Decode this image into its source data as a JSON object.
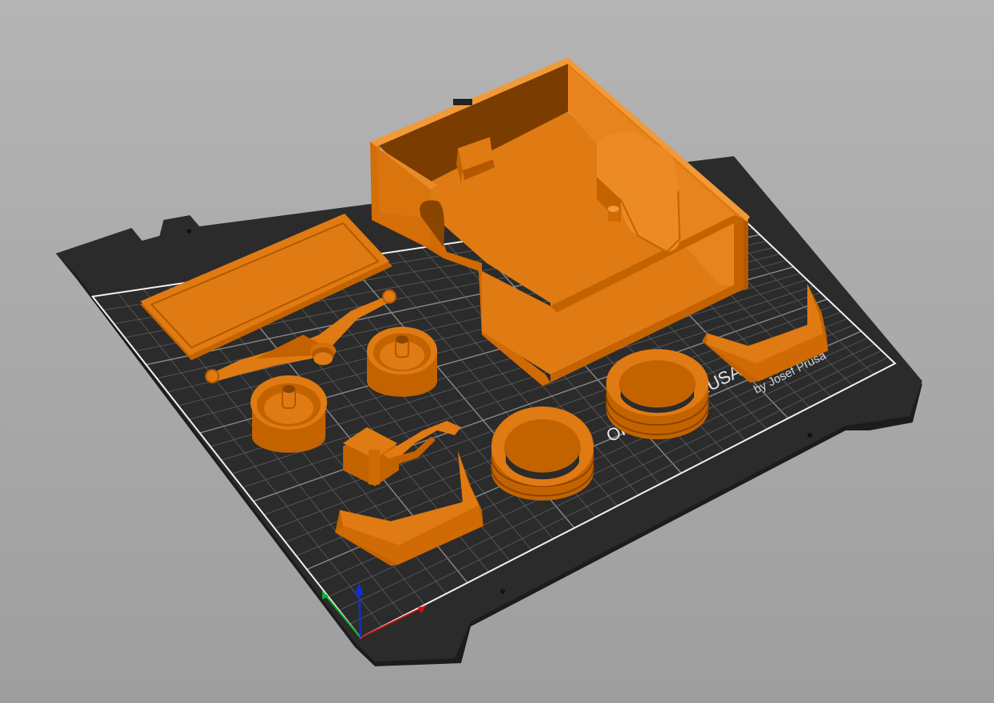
{
  "viewport": {
    "background_top": "#b4b4b4",
    "background_bottom": "#9e9e9e"
  },
  "bed": {
    "color": "#2a2a2a",
    "edge_color": "#1c1c1c",
    "grid_color": "#5e5e5e",
    "border_color": "#f2f2f2",
    "logo_text_main": "ORIGINAL PRUSA",
    "logo_text_sub": "by Josef Prusa"
  },
  "parts": {
    "color_front": "#e07a12",
    "color_side": "#c36300",
    "color_dark": "#8a4500",
    "color_top": "#ec8a24",
    "items": [
      {
        "id": "truck-bed-box"
      },
      {
        "id": "flat-plate"
      },
      {
        "id": "y-arm"
      },
      {
        "id": "wheel-rim-back"
      },
      {
        "id": "wheel-rim-front"
      },
      {
        "id": "tire-front"
      },
      {
        "id": "tire-back"
      },
      {
        "id": "fender-right"
      },
      {
        "id": "fender-left"
      },
      {
        "id": "linkage-bracket"
      }
    ]
  },
  "axes": {
    "x_color": "#d01010",
    "y_color": "#10b030",
    "z_color": "#1030d0"
  }
}
